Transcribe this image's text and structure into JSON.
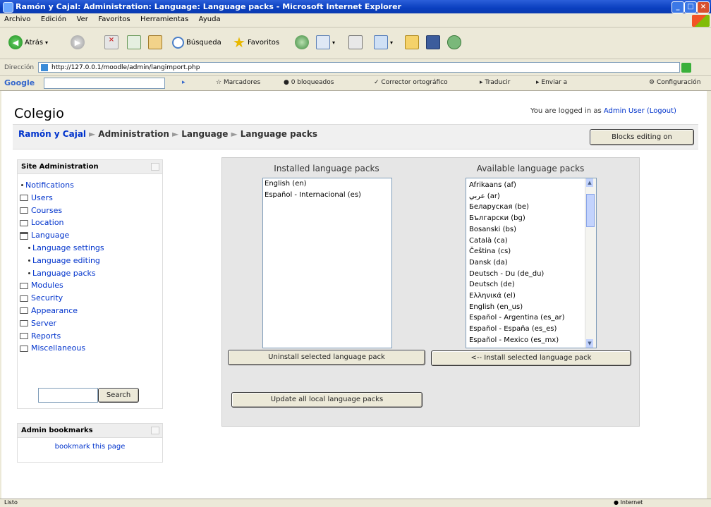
{
  "window": {
    "title": "Ramón y Cajal: Administration: Language: Language packs - Microsoft Internet Explorer"
  },
  "menu": [
    "Archivo",
    "Edición",
    "Ver",
    "Favoritos",
    "Herramientas",
    "Ayuda"
  ],
  "toolbar": {
    "back": "Atrás",
    "search": "Búsqueda",
    "favorites": "Favoritos"
  },
  "address": {
    "label": "Dirección",
    "url": "http://127.0.0.1/moodle/admin/langimport.php"
  },
  "googlebar": {
    "logo": "Google",
    "bookmarks": "Marcadores",
    "blocked": "0 bloqueados",
    "spell": "Corrector ortográfico",
    "translate": "Traducir",
    "send": "Enviar a",
    "settings": "Configuración"
  },
  "header": {
    "site_name": "Colegio",
    "logged_prefix": "You are logged in as",
    "user": "Admin User",
    "logout": "(Logout)"
  },
  "breadcrumb": {
    "home": "Ramón y Cajal",
    "admin": "Administration",
    "lang": "Language",
    "current": "Language packs"
  },
  "blocks_editing_button": "Blocks editing on",
  "site_admin": {
    "title": "Site Administration",
    "items": {
      "notifications": "Notifications",
      "users": "Users",
      "courses": "Courses",
      "location": "Location",
      "language": "Language",
      "lang_settings": "Language settings",
      "lang_editing": "Language editing",
      "lang_packs": "Language packs",
      "modules": "Modules",
      "security": "Security",
      "appearance": "Appearance",
      "server": "Server",
      "reports": "Reports",
      "misc": "Miscellaneous"
    },
    "search_button": "Search"
  },
  "admin_bookmarks": {
    "title": "Admin bookmarks",
    "link": "bookmark this page"
  },
  "installed": {
    "caption": "Installed language packs",
    "items": [
      "English (en)",
      "Español - Internacional (es)"
    ]
  },
  "available": {
    "caption": "Available language packs",
    "items": [
      "Afrikaans (af)",
      "عربي (ar)",
      "Беларуская (be)",
      "Български (bg)",
      "Bosanski (bs)",
      "Català (ca)",
      "Čeština (cs)",
      "Dansk (da)",
      "Deutsch - Du (de_du)",
      "Deutsch (de)",
      "Ελληνικά (el)",
      "English (en_us)",
      "Español - Argentina (es_ar)",
      "Español - España (es_es)",
      "Español - Mexico (es_mx)"
    ]
  },
  "buttons": {
    "uninstall": "Uninstall selected language pack",
    "install": "<-- Install selected language pack",
    "update": "Update all local language packs"
  },
  "statusbar": {
    "left": "Listo",
    "right": "Internet"
  }
}
